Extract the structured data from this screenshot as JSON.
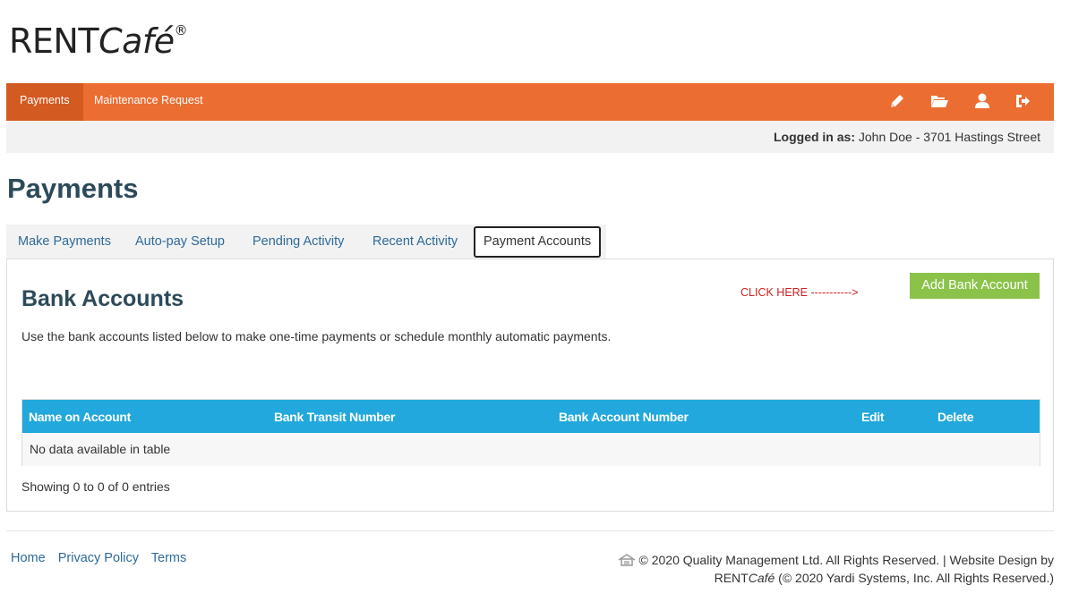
{
  "brand": {
    "logo_rent": "RENT",
    "logo_cafe": "Café",
    "logo_reg": "®"
  },
  "nav": {
    "items": [
      {
        "label": "Payments",
        "active": true
      },
      {
        "label": "Maintenance Request",
        "active": false
      }
    ],
    "icons": [
      "pencil-icon",
      "folder-open-icon",
      "user-icon",
      "sign-out-icon"
    ],
    "color": "#ec6d31"
  },
  "user": {
    "logged_label": "Logged in as:",
    "name": "John Doe - 3701 Hastings Street"
  },
  "page": {
    "title": "Payments"
  },
  "tabs": [
    {
      "label": "Make Payments"
    },
    {
      "label": "Auto-pay Setup"
    },
    {
      "label": "Pending Activity"
    },
    {
      "label": "Recent Activity"
    },
    {
      "label": "Payment Accounts",
      "active": true
    }
  ],
  "bank": {
    "title": "Bank Accounts",
    "description": "Use the bank accounts listed below to make one-time payments or schedule monthly automatic payments.",
    "annotation": "CLICK HERE ----------->",
    "add_button": "Add Bank Account"
  },
  "table": {
    "columns": [
      "Name on Account",
      "Bank Transit Number",
      "Bank Account Number",
      "Edit",
      "Delete"
    ],
    "empty_message": "No data available in table",
    "showing": "Showing 0 to 0 of 0 entries"
  },
  "footer": {
    "links": [
      "Home",
      "Privacy Policy",
      "Terms"
    ],
    "copyright_line1": "© 2020 Quality Management Ltd. All Rights Reserved. | Website Design by",
    "copyright_rent": "RENT",
    "copyright_cafe": "Café",
    "copyright_line2": " (© 2020 Yardi Systems, Inc. All Rights Reserved.)"
  }
}
